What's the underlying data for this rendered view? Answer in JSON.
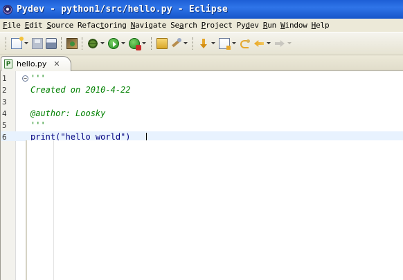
{
  "window": {
    "title": "Pydev - python1/src/hello.py - Eclipse"
  },
  "menu": [
    {
      "label": "File",
      "mnemonic": "F",
      "rest": "ile"
    },
    {
      "label": "Edit",
      "mnemonic": "E",
      "rest": "dit"
    },
    {
      "label": "Source",
      "mnemonic": "S",
      "rest": "ource"
    },
    {
      "label": "Refactoring",
      "pre": "Refac",
      "mnemonic": "t",
      "rest": "oring"
    },
    {
      "label": "Navigate",
      "mnemonic": "N",
      "rest": "avigate"
    },
    {
      "label": "Search",
      "pre": "Se",
      "mnemonic": "a",
      "rest": "rch"
    },
    {
      "label": "Project",
      "mnemonic": "P",
      "rest": "roject"
    },
    {
      "label": "Pydev",
      "pre": "Py",
      "mnemonic": "d",
      "rest": "ev"
    },
    {
      "label": "Run",
      "mnemonic": "R",
      "rest": "un"
    },
    {
      "label": "Window",
      "mnemonic": "W",
      "rest": "indow"
    },
    {
      "label": "Help",
      "mnemonic": "H",
      "rest": "elp"
    }
  ],
  "toolbar": {
    "icons": [
      "new-icon",
      "save-icon",
      "print-icon",
      "package-icon",
      "debug-icon",
      "run-icon",
      "external-tools-icon",
      "open-folder-icon",
      "search-icon",
      "next-annotation-icon",
      "prev-annotation-icon",
      "last-edit-icon",
      "back-icon",
      "forward-icon"
    ]
  },
  "editor": {
    "tab_label": "hello.py",
    "tab_icon": "P",
    "close_glyph": "✕",
    "lines": [
      {
        "number": "1",
        "text": "'''"
      },
      {
        "number": "2",
        "text": "Created on 2010-4-22"
      },
      {
        "number": "3",
        "text": ""
      },
      {
        "number": "4",
        "text": "@author: Loosky"
      },
      {
        "number": "5",
        "text": "'''"
      },
      {
        "number": "6",
        "text": "print(\"hello world\")"
      }
    ]
  },
  "colors": {
    "titlebar": "#2f74e8",
    "comment": "#008000",
    "keyword": "#00007f",
    "current_line": "#e8f2fe"
  }
}
